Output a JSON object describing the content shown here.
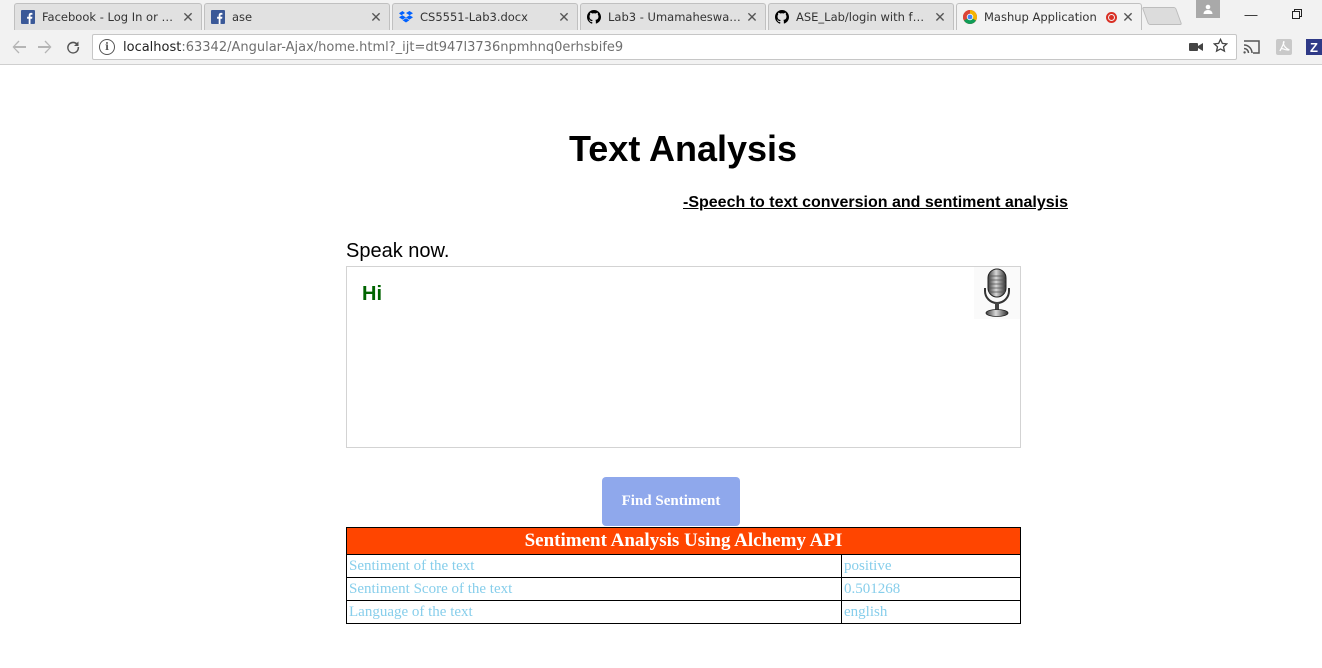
{
  "browser": {
    "tabs": [
      {
        "title": "Facebook - Log In or Sig",
        "icon": "facebook-icon"
      },
      {
        "title": "ase",
        "icon": "facebook-icon"
      },
      {
        "title": "CS5551-Lab3.docx",
        "icon": "dropbox-icon"
      },
      {
        "title": "Lab3 - Umamaheswarare",
        "icon": "github-icon"
      },
      {
        "title": "ASE_Lab/login with face",
        "icon": "github-icon"
      },
      {
        "title": "Mashup Application",
        "icon": "chrome-icon",
        "active": true
      }
    ],
    "url_host": "localhost",
    "url_rest": ":63342/Angular-Ajax/home.html?_ijt=dt947l3736npmhnq0erhsbife9"
  },
  "page": {
    "title": "Text Analysis",
    "subtitle": "-Speech to text conversion and sentiment analysis",
    "speak_prompt": "Speak now.",
    "spoken_text": "Hi",
    "mic_icon": "microphone-icon",
    "button_label": "Find Sentiment"
  },
  "results": {
    "header": "Sentiment Analysis Using Alchemy API",
    "rows": [
      {
        "label": "Sentiment of the text",
        "value": "positive"
      },
      {
        "label": "Sentiment Score of the text",
        "value": "0.501268"
      },
      {
        "label": "Language of the text",
        "value": "english"
      }
    ]
  },
  "colors": {
    "button": "#8fa8ec",
    "table_header": "#ff4500",
    "table_text": "#87ceeb",
    "spoken_text": "#006400"
  }
}
